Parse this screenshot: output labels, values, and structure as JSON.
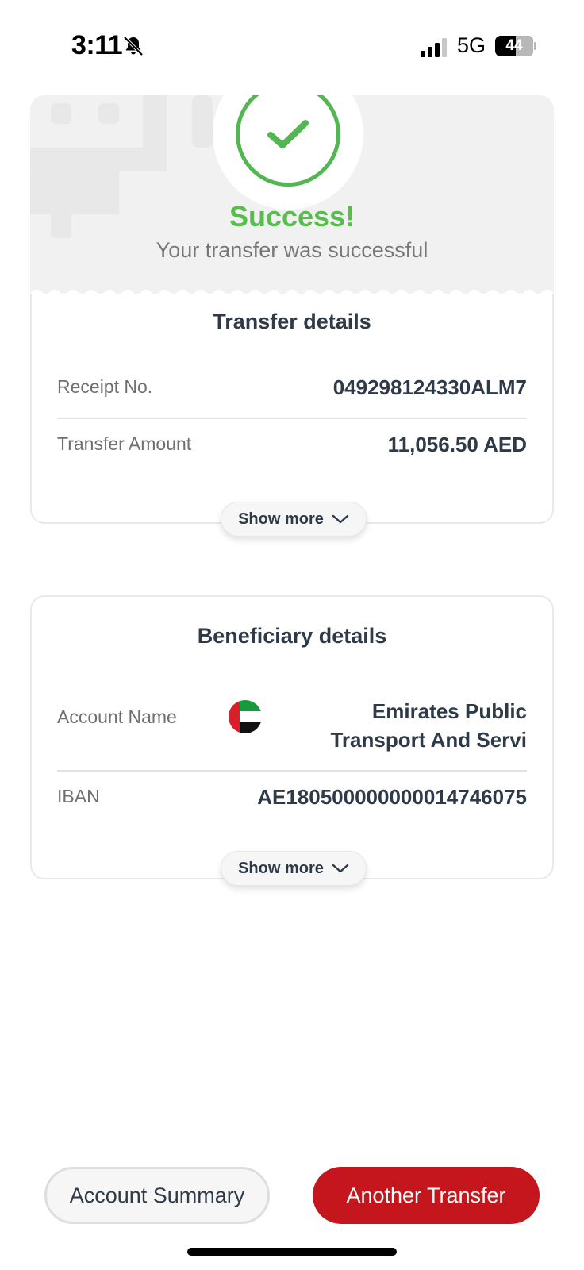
{
  "status_bar": {
    "time": "3:11",
    "network": "5G",
    "battery": "44"
  },
  "hero": {
    "title": "Success!",
    "subtitle": "Your transfer was successful"
  },
  "transfer_details": {
    "title": "Transfer details",
    "receipt_label": "Receipt No.",
    "receipt_value": "049298124330ALM7",
    "amount_label": "Transfer Amount",
    "amount_value": "11,056.50 AED",
    "show_more": "Show more"
  },
  "beneficiary_details": {
    "title": "Beneficiary details",
    "account_name_label": "Account Name",
    "account_name_line1": "Emirates Public",
    "account_name_line2": "Transport And Servi",
    "iban_label": "IBAN",
    "iban_value": "AE180500000000014746075",
    "show_more": "Show more"
  },
  "actions": {
    "secondary": "Account Summary",
    "primary": "Another Transfer"
  },
  "colors": {
    "success": "#58bd4d",
    "brand_red": "#c4161c",
    "text_dark": "#2f3a48"
  },
  "icons": [
    "bell-slash-icon",
    "signal-icon",
    "battery-icon",
    "checkmark-icon",
    "chevron-down-icon",
    "uae-flag-icon"
  ]
}
